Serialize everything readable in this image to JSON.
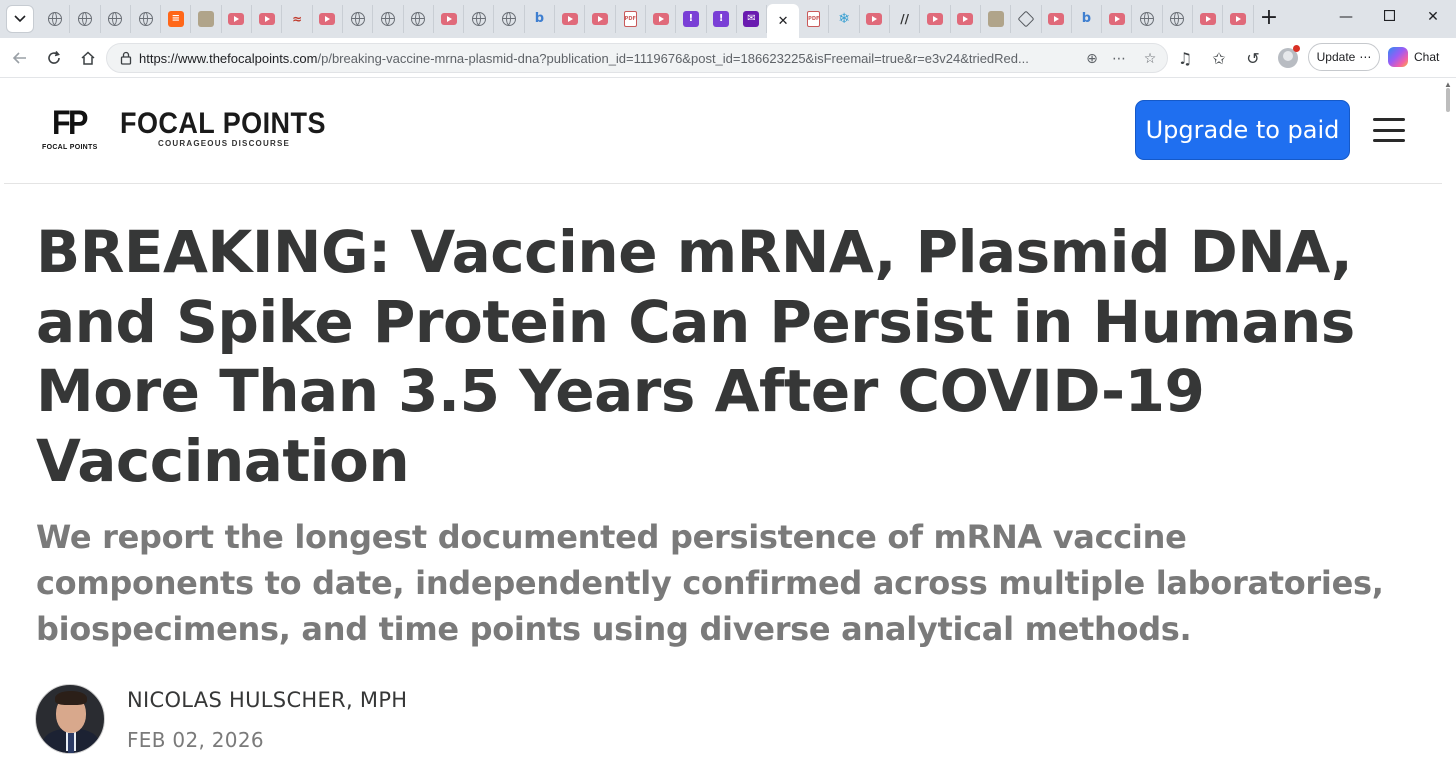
{
  "browser": {
    "tabs": [
      {
        "icon": "globe-icon"
      },
      {
        "icon": "globe-icon"
      },
      {
        "icon": "globe-icon"
      },
      {
        "icon": "globe-icon"
      },
      {
        "icon": "substack-icon"
      },
      {
        "icon": "image-icon"
      },
      {
        "icon": "youtube-icon"
      },
      {
        "icon": "youtube-icon"
      },
      {
        "icon": "red-bird-icon"
      },
      {
        "icon": "youtube-icon"
      },
      {
        "icon": "globe-icon"
      },
      {
        "icon": "globe-icon"
      },
      {
        "icon": "globe-icon"
      },
      {
        "icon": "youtube-icon"
      },
      {
        "icon": "globe-icon"
      },
      {
        "icon": "globe-icon"
      },
      {
        "icon": "bing-icon"
      },
      {
        "icon": "youtube-icon"
      },
      {
        "icon": "youtube-icon"
      },
      {
        "icon": "pdf-icon"
      },
      {
        "icon": "youtube-icon"
      },
      {
        "icon": "yahoo-icon"
      },
      {
        "icon": "yahoo-icon"
      },
      {
        "icon": "mail-icon"
      },
      {
        "icon": "close-icon",
        "active": true
      },
      {
        "icon": "pdf-icon"
      },
      {
        "icon": "snowflake-icon"
      },
      {
        "icon": "youtube-icon"
      },
      {
        "icon": "slash-icon"
      },
      {
        "icon": "youtube-icon"
      },
      {
        "icon": "youtube-icon"
      },
      {
        "icon": "image-icon"
      },
      {
        "icon": "diamond-icon"
      },
      {
        "icon": "youtube-icon"
      },
      {
        "icon": "bing-icon"
      },
      {
        "icon": "youtube-icon"
      },
      {
        "icon": "globe-icon"
      },
      {
        "icon": "globe-icon"
      },
      {
        "icon": "youtube-icon"
      },
      {
        "icon": "youtube-icon"
      }
    ],
    "url_host": "https://www.thefocalpoints.com",
    "url_rest": "/p/breaking-vaccine-mrna-plasmid-dna?publication_id=1119676&post_id=186623225&isFreemail=true&r=e3v24&triedRed...",
    "update_label": "Update",
    "chat_label": "Chat"
  },
  "site": {
    "logo_mark": "FP",
    "logo_mark_caption": "FOCAL POINTS",
    "name": "FOCAL POINTS",
    "tagline": "COURAGEOUS DISCOURSE",
    "upgrade_label": "Upgrade to paid"
  },
  "post": {
    "title": "BREAKING: Vaccine mRNA, Plasmid DNA, and Spike Protein Can Persist in Humans More Than 3.5 Years After COVID-19 Vaccination",
    "subtitle": "We report the longest documented persistence of mRNA vaccine components to date, independently confirmed across multiple laboratories, biospecimens, and time points using diverse analytical methods.",
    "author": "NICOLAS HULSCHER, MPH",
    "date": "FEB 02, 2026"
  },
  "colors": {
    "accent": "#1f6ff0",
    "text": "#363737",
    "muted": "#7a7a7a"
  }
}
